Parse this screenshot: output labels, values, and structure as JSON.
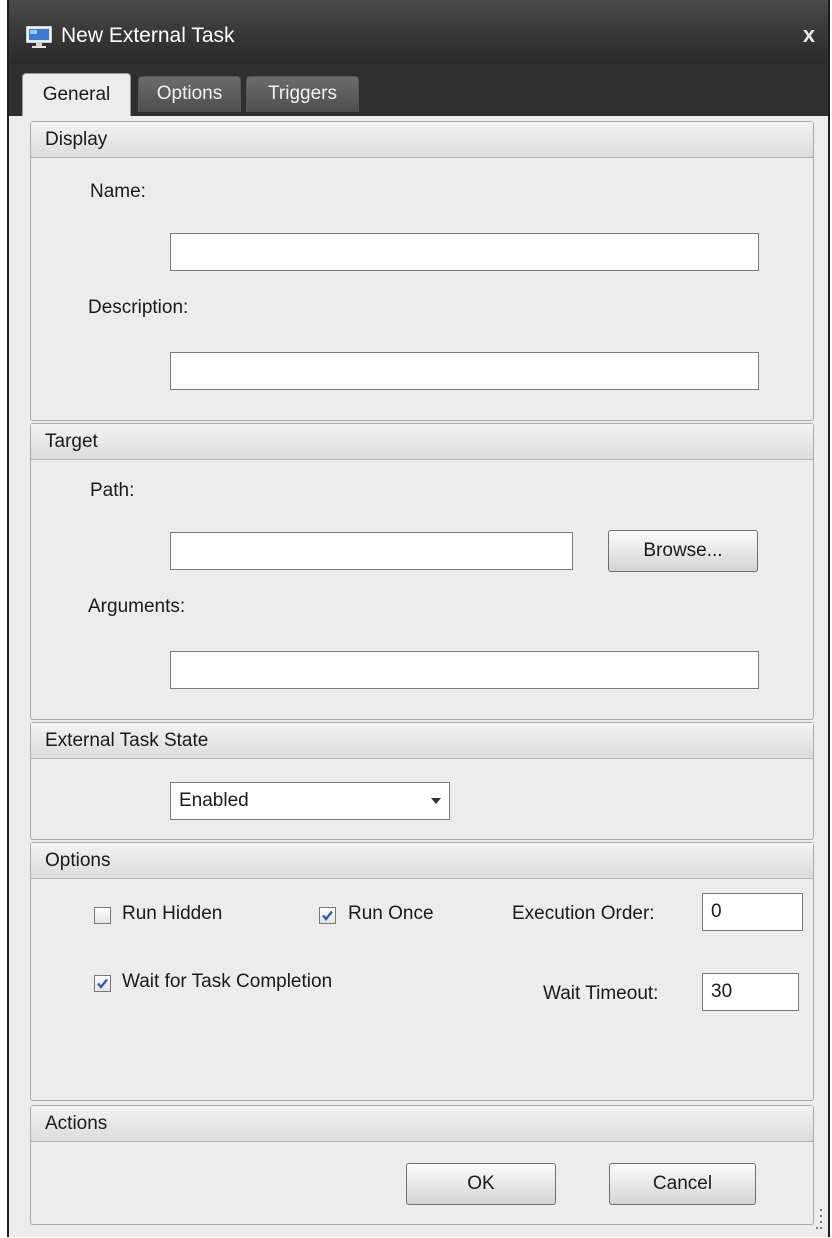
{
  "window": {
    "title": "New External Task",
    "close_glyph": "x",
    "icon": "computer-monitor-icon"
  },
  "tabs": [
    {
      "label": "General",
      "active": true
    },
    {
      "label": "Options",
      "active": false
    },
    {
      "label": "Triggers",
      "active": false
    }
  ],
  "display": {
    "header": "Display",
    "name_label": "Name:",
    "name_value": "",
    "description_label": "Description:",
    "description_value": ""
  },
  "target": {
    "header": "Target",
    "path_label": "Path:",
    "path_value": "",
    "browse_label": "Browse...",
    "arguments_label": "Arguments:",
    "arguments_value": ""
  },
  "state": {
    "header": "External Task State",
    "selected": "Enabled"
  },
  "options": {
    "header": "Options",
    "run_hidden_label": "Run Hidden",
    "run_hidden_checked": false,
    "run_once_label": "Run Once",
    "run_once_checked": true,
    "execution_order_label": "Execution Order:",
    "execution_order_value": "0",
    "wait_completion_label": "Wait for Task Completion",
    "wait_completion_checked": true,
    "wait_timeout_label": "Wait Timeout:",
    "wait_timeout_value": "30"
  },
  "actions": {
    "header": "Actions",
    "ok_label": "OK",
    "cancel_label": "Cancel"
  },
  "colors": {
    "titlebar": "#3a3a3a",
    "panel": "#ececec",
    "check_accent": "#2c5fb3"
  }
}
